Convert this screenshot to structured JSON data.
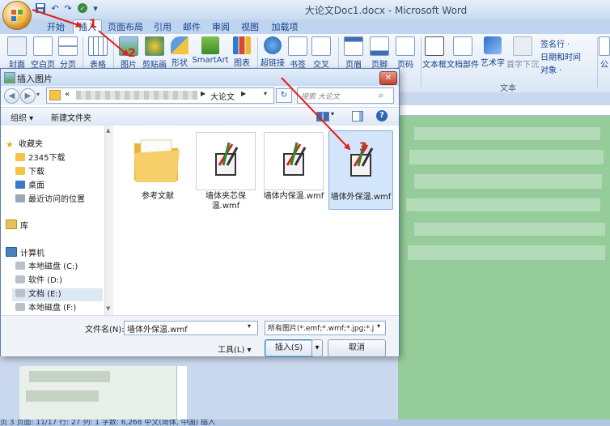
{
  "window": {
    "title": "大论文Doc1.docx - Microsoft Word"
  },
  "ribbon": {
    "tabs": [
      "开始",
      "插入",
      "页面布局",
      "引用",
      "邮件",
      "审阅",
      "视图",
      "加载项"
    ],
    "buttons": [
      "封面",
      "空白页",
      "分页",
      "表格",
      "图片",
      "剪贴画",
      "形状",
      "SmartArt",
      "图表",
      "超链接",
      "书签",
      "交叉",
      "页眉",
      "页脚",
      "页码",
      "文本框",
      "文档部件",
      "艺术字",
      "首字下沉",
      "公"
    ],
    "right_items": [
      "签名行 ·",
      "日期和时间",
      "对象 ·"
    ],
    "text_group_label": "文本"
  },
  "dialog": {
    "title": "插入图片",
    "breadcrumb_prefix": "«",
    "current_folder": "大论文",
    "search_placeholder": "搜索 大论文",
    "toolbar": {
      "organize": "组织 ▾",
      "new_folder": "新建文件夹"
    },
    "nav_items": [
      "收藏夹",
      "2345下载",
      "下载",
      "桌面",
      "最近访问的位置",
      "库",
      "计算机",
      "本地磁盘 (C:)",
      "软件 (D:)",
      "文档 (E:)",
      "本地磁盘 (F:)"
    ],
    "files": [
      {
        "name": "参考文献"
      },
      {
        "name": "墙体夹芯保温.wmf"
      },
      {
        "name": "墙体内保温.wmf"
      },
      {
        "name": "墙体外保温.wmf"
      }
    ],
    "filename_label": "文件名(N):",
    "filename_value": "墙体外保温.wmf",
    "filetype_value": "所有图片(*.emf;*.wmf;*.jpg;*.jp",
    "tools_label": "工具(L)",
    "insert_label": "插入(S)",
    "cancel_label": "取消"
  },
  "annotations": {
    "step1": "1",
    "step2": "2",
    "step3": "3",
    "arrow_color": "#e0201a"
  },
  "statusbar": {
    "text": "页 3   页面: 11/17   行: 27   列: 1   字数: 6,268   中文(简体, 中国)   插入"
  }
}
